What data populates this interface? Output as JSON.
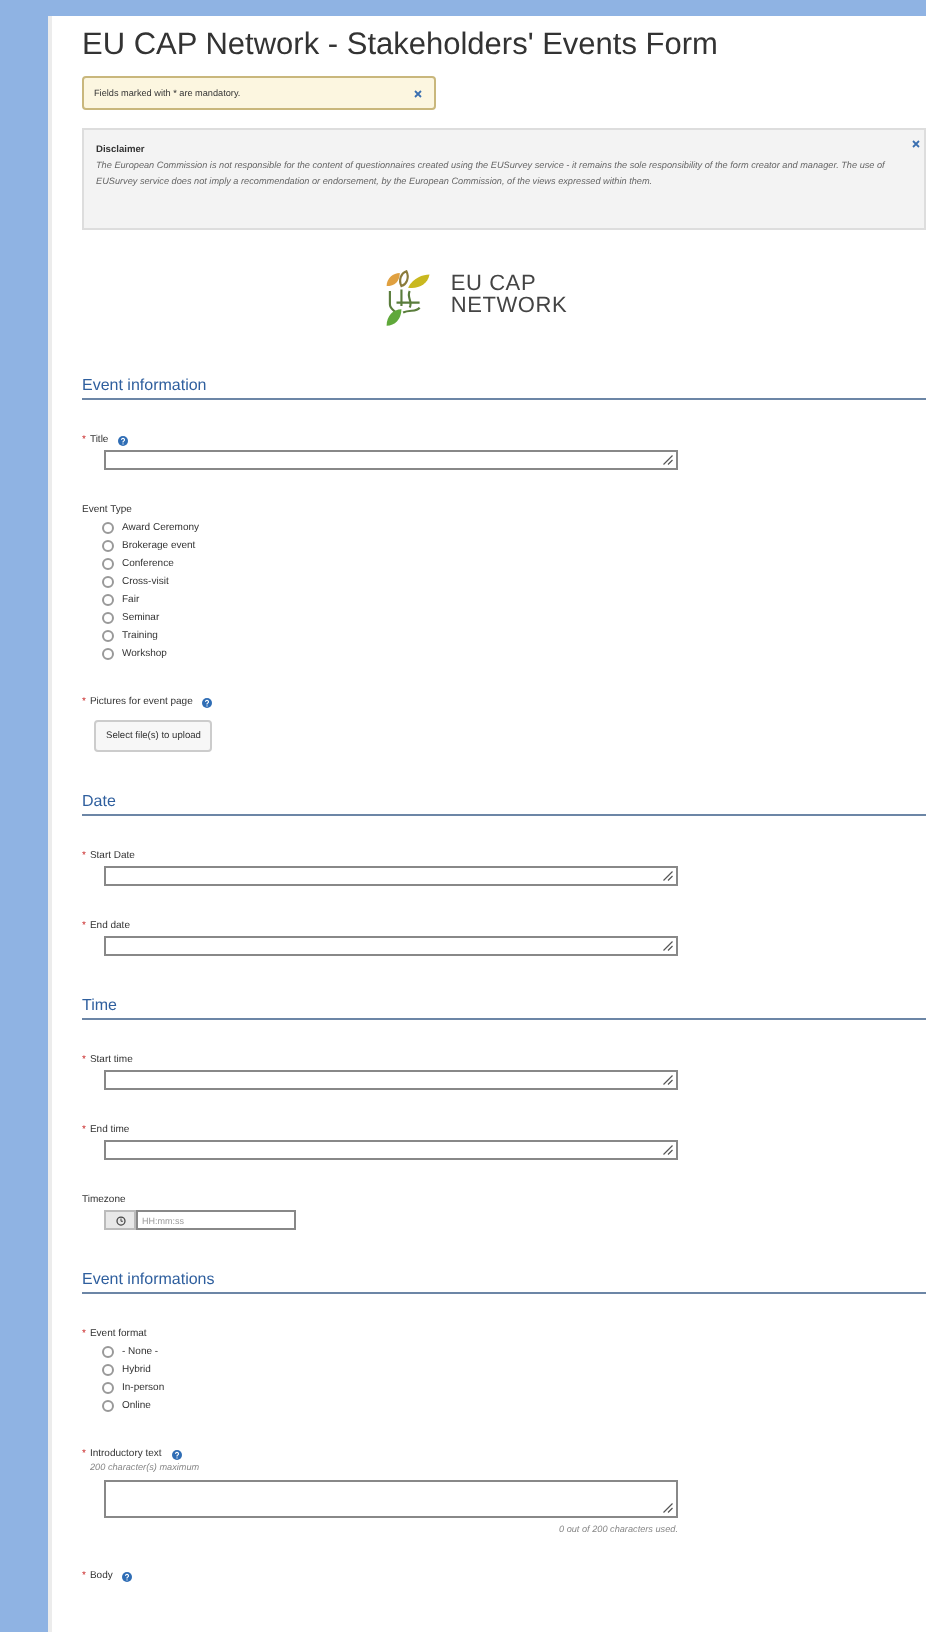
{
  "page_title": "EU CAP Network - Stakeholders' Events Form",
  "notice": {
    "text": "Fields marked with * are mandatory."
  },
  "disclaimer": {
    "heading": "Disclaimer",
    "text": "The European Commission is not responsible for the content of questionnaires created using the EUSurvey service - it remains the sole responsibility of the form creator and manager. The use of EUSurvey service does not imply a recommendation or endorsement, by the European Commission, of the views expressed within them."
  },
  "logo": {
    "line1": "EU CAP",
    "line2": "NETWORK"
  },
  "sections": [
    {
      "title": "Event information",
      "fields": [
        {
          "kind": "textarea",
          "mark": "*",
          "label": "Title",
          "help": true
        },
        {
          "kind": "radio",
          "label": "Event Type",
          "help": false,
          "options": [
            {
              "label": "Award Ceremony",
              "selected": false
            },
            {
              "label": "Brokerage event",
              "selected": false
            },
            {
              "label": "Conference",
              "selected": false
            },
            {
              "label": "Cross-visit",
              "selected": false
            },
            {
              "label": "Fair",
              "selected": false
            },
            {
              "label": "Seminar",
              "selected": false
            },
            {
              "label": "Training",
              "selected": false
            },
            {
              "label": "Workshop",
              "selected": false
            }
          ]
        },
        {
          "kind": "upload",
          "mark": "*",
          "label": "Pictures for event page",
          "help": true,
          "button": "Select file(s) to upload"
        }
      ]
    },
    {
      "title": "Date",
      "fields": [
        {
          "kind": "textarea",
          "mark": "*",
          "label": "Start Date",
          "help": false
        },
        {
          "kind": "textarea",
          "mark": "*",
          "label": "End date",
          "help": false
        }
      ]
    },
    {
      "title": "Time",
      "fields": [
        {
          "kind": "textarea",
          "mark": "*",
          "label": "Start time",
          "help": false
        },
        {
          "kind": "textarea",
          "mark": "*",
          "label": "End time",
          "help": false
        },
        {
          "kind": "time",
          "label": "Timezone",
          "help": false,
          "placeholder": "HH:mm:ss"
        }
      ]
    },
    {
      "title": "Event informations",
      "fields": [
        {
          "kind": "radio",
          "mark": "*",
          "label": "Event format",
          "help": false,
          "options": [
            {
              "label": "- None -",
              "selected": false
            },
            {
              "label": "Hybrid",
              "selected": false
            },
            {
              "label": "In-person",
              "selected": false
            },
            {
              "label": "Online",
              "selected": false
            }
          ]
        },
        {
          "kind": "limited",
          "mark": "*",
          "label": "Introductory text",
          "help": true,
          "hint": "200 character(s) maximum",
          "counter": "0 out of 200 characters used."
        },
        {
          "kind": "label",
          "mark": "*",
          "label": "Body",
          "help": true
        }
      ]
    }
  ]
}
